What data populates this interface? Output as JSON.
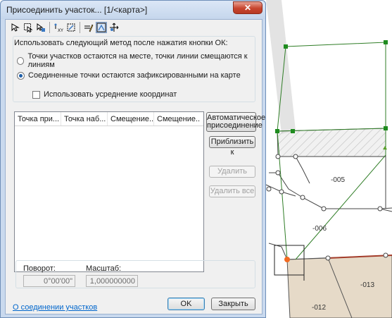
{
  "window": {
    "title": "Присоединить участок... [1/<карта>]",
    "close_glyph": "✕"
  },
  "toolbar": {
    "buttons": [
      {
        "icon": "select-point-icon",
        "active": false
      },
      {
        "icon": "select-area-icon",
        "active": false
      },
      {
        "icon": "select-next-icon",
        "active": false
      },
      {
        "icon": "xy-icon",
        "active": false
      },
      {
        "icon": "snap-icon",
        "active": false
      },
      {
        "icon": "pencil-line-icon",
        "active": false
      },
      {
        "icon": "adjust-icon",
        "active": true
      },
      {
        "icon": "move-point-icon",
        "active": false
      }
    ]
  },
  "method": {
    "label": "Использовать следующий метод после нажатия кнопки ОК:",
    "options": [
      {
        "label": "Точки участков остаются на месте, точки линии смещаются к линиям",
        "selected": false
      },
      {
        "label": "Соединенные точки остаются зафиксированными на карте",
        "selected": true
      }
    ],
    "averaging": {
      "label": "Использовать усреднение координат",
      "checked": false
    }
  },
  "table": {
    "columns": [
      "Точка при...",
      "Точка наб...",
      "Смещение...",
      "Смещение..."
    ],
    "rows": []
  },
  "buttons": {
    "auto_join": [
      "Автоматическое",
      "присоединение"
    ],
    "zoom_to": "Приблизить к",
    "delete": "Удалить",
    "delete_all": "Удалить все",
    "ok": "OK",
    "close": "Закрыть"
  },
  "transform": {
    "rotation_label": "Поворот:",
    "rotation_value": "0°00'00\"",
    "scale_label": "Масштаб:",
    "scale_value": "1,000000000"
  },
  "help_link": "О соединении участков",
  "map": {
    "parcel_labels": [
      "-005",
      "-006",
      "-013",
      "-012"
    ],
    "colors": {
      "line": "#2f7d26",
      "parcel_fill": "#e6dac8",
      "hatch": "#c8c8c8",
      "highlight_line": "#a33c2a",
      "selected_point": "#f26a21"
    }
  }
}
